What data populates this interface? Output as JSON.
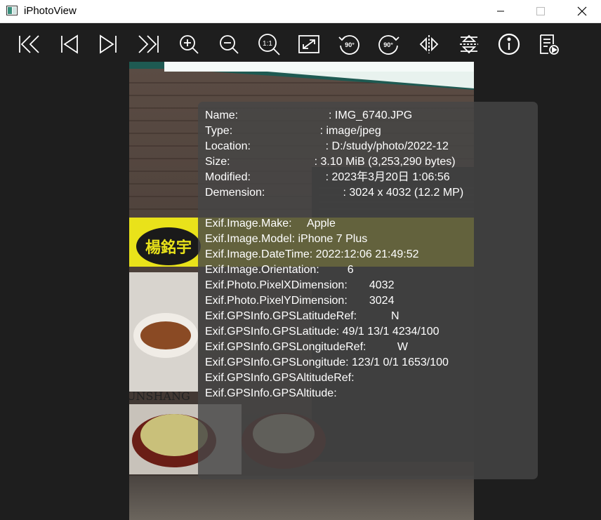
{
  "window": {
    "title": "iPhotoView",
    "colors": {
      "titlebar": "#ffffff",
      "toolbar": "#1e1e1e",
      "background": "#1e1e1e",
      "panel": "#464646"
    }
  },
  "toolbar": {
    "buttons": [
      {
        "name": "first-image-button",
        "icon": "skip-first-icon"
      },
      {
        "name": "previous-image-button",
        "icon": "previous-icon"
      },
      {
        "name": "next-image-button",
        "icon": "next-icon"
      },
      {
        "name": "last-image-button",
        "icon": "skip-last-icon"
      },
      {
        "name": "zoom-in-button",
        "icon": "zoom-in-icon"
      },
      {
        "name": "zoom-out-button",
        "icon": "zoom-out-icon"
      },
      {
        "name": "actual-size-button",
        "icon": "zoom-actual-size-icon",
        "label": "1:1"
      },
      {
        "name": "fit-window-button",
        "icon": "expand-icon"
      },
      {
        "name": "rotate-left-button",
        "icon": "rotate-ccw-icon",
        "label": "90°"
      },
      {
        "name": "rotate-right-button",
        "icon": "rotate-cw-icon",
        "label": "90°"
      },
      {
        "name": "flip-horizontal-button",
        "icon": "flip-horizontal-icon"
      },
      {
        "name": "flip-vertical-button",
        "icon": "flip-vertical-icon"
      },
      {
        "name": "info-button",
        "icon": "info-icon"
      },
      {
        "name": "slideshow-button",
        "icon": "document-play-icon"
      }
    ]
  },
  "photo": {
    "sign_text": "楊銘宇",
    "shop_text": "UNSHANG"
  },
  "info": {
    "lines": [
      "Name:                             : IMG_6740.JPG",
      "Type:                            : image/jpeg",
      "Location:                        : D:/study/photo/2022-12",
      "Size:                           : 3.10 MiB (3,253,290 bytes)",
      "Modified:                        : 2023年3月20日 1:06:56",
      "Demension:                         : 3024 x 4032 (12.2 MP)",
      "",
      "Exif.Image.Make:     Apple",
      "Exif.Image.Model: iPhone 7 Plus",
      "Exif.Image.DateTime: 2022:12:06 21:49:52",
      "Exif.Image.Orientation:         6",
      "Exif.Photo.PixelXDimension:       4032",
      "Exif.Photo.PixelYDimension:       3024",
      "Exif.GPSInfo.GPSLatitudeRef:           N",
      "Exif.GPSInfo.GPSLatitude: 49/1 13/1 4234/100",
      "Exif.GPSInfo.GPSLongitudeRef:          W",
      "Exif.GPSInfo.GPSLongitude: 123/1 0/1 1653/100",
      "Exif.GPSInfo.GPSAltitudeRef:",
      "Exif.GPSInfo.GPSAltitude:"
    ]
  }
}
